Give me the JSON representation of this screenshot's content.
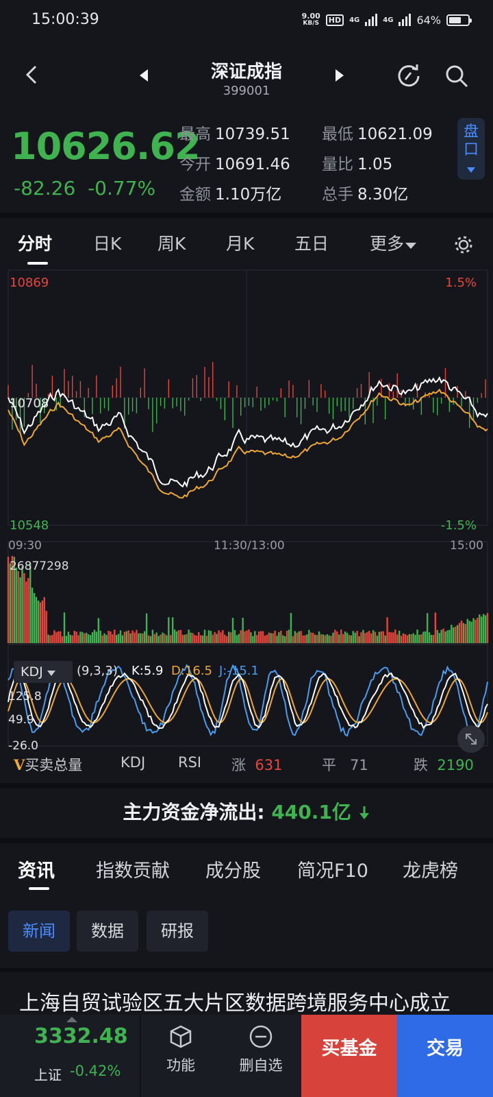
{
  "status": {
    "time": "15:00:39",
    "net_speed": "9.00",
    "net_unit": "KB/S",
    "hd": "HD",
    "sig1": "4G",
    "sig2": "4G",
    "battery": "64%",
    "battery_level": 0.64
  },
  "header": {
    "title": "深证成指",
    "code": "399001"
  },
  "quote": {
    "price": "10626.62",
    "change": "-82.26",
    "change_pct": "-0.77%",
    "high_label": "最高",
    "high": "10739.51",
    "low_label": "最低",
    "low": "10621.09",
    "open_label": "今开",
    "open": "10691.46",
    "vr_label": "量比",
    "vr": "1.05",
    "amount_label": "金额",
    "amount": "1.10万亿",
    "turnover_label": "总手",
    "turnover": "8.30亿",
    "pankou": "盘口"
  },
  "tabs": [
    "分时",
    "日K",
    "周K",
    "月K",
    "五日",
    "更多"
  ],
  "chart": {
    "y_top": "10869",
    "y_top_pct": "1.5%",
    "y_mid": "10708",
    "y_bot": "10548",
    "y_bot_pct": "-1.5%",
    "t_start": "09:30",
    "t_mid": "11:30/13:00",
    "t_end": "15:00",
    "vol_max": "26877298",
    "kdj_name": "KDJ",
    "kdj_params": "(9,3,3)",
    "k": "K:5.9",
    "d": "D:16.5",
    "j": "J:-15.1",
    "kdj_top": "125.8",
    "kdj_mid": "49.9",
    "kdj_bot": "-26.0",
    "colors": {
      "price": "#ffffff",
      "avg": "#f0a830",
      "up": "#e8453c",
      "down": "#3fb34f",
      "j": "#4a9cf0"
    }
  },
  "indicator_bar": {
    "v_label": "买卖总量",
    "kdj": "KDJ",
    "rsi": "RSI",
    "up_label": "涨",
    "up": "631",
    "flat_label": "平",
    "flat": "71",
    "down_label": "跌",
    "down": "2190"
  },
  "flow": {
    "label": "主力资金净流出:",
    "value": "440.1亿"
  },
  "sub_tabs": [
    "资讯",
    "指数贡献",
    "成分股",
    "简况F10",
    "龙虎榜"
  ],
  "chips": [
    "新闻",
    "数据",
    "研报"
  ],
  "news_headline": "上海自贸试验区五大片区数据跨境服务中心成立",
  "bottom": {
    "index_price": "3332.48",
    "index_name": "上证",
    "index_pct": "-0.42%",
    "func": "功能",
    "del": "删自选",
    "buy_fund": "买基金",
    "trade": "交易"
  }
}
